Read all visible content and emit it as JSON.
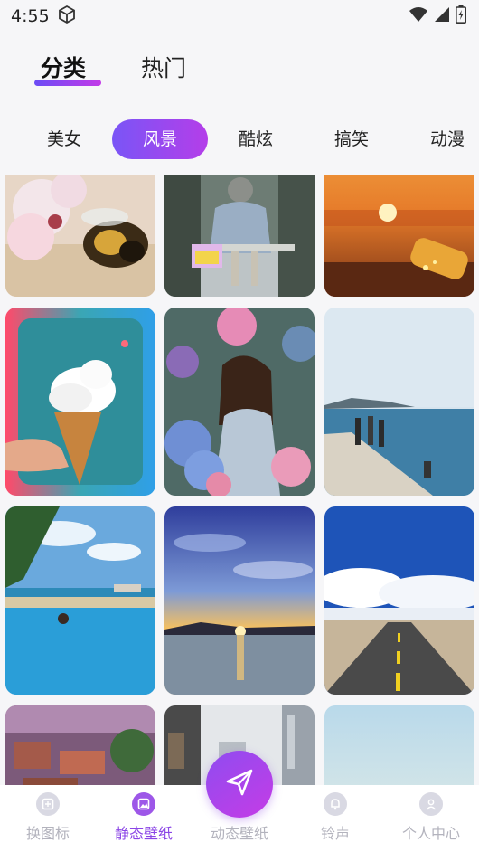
{
  "status_bar": {
    "time": "4:55",
    "icons": [
      "box-icon",
      "wifi-icon",
      "signal-icon",
      "battery-icon"
    ]
  },
  "top_tabs": [
    {
      "label": "分类",
      "active": true
    },
    {
      "label": "热门",
      "active": false
    }
  ],
  "categories": [
    {
      "label": "美女",
      "active": false
    },
    {
      "label": "风景",
      "active": true
    },
    {
      "label": "酷炫",
      "active": false
    },
    {
      "label": "搞笑",
      "active": false
    },
    {
      "label": "动漫",
      "active": false
    }
  ],
  "wallpapers": [
    {
      "subject": "bee-on-blossom"
    },
    {
      "subject": "girl-on-swing"
    },
    {
      "subject": "sunset-bottle-on-beach"
    },
    {
      "subject": "cloud-ice-cream-cone"
    },
    {
      "subject": "girl-in-flowers"
    },
    {
      "subject": "people-on-pier-by-sea"
    },
    {
      "subject": "infinity-pool-tropical"
    },
    {
      "subject": "sunset-over-lake"
    },
    {
      "subject": "road-under-blue-sky"
    },
    {
      "subject": "village-houses"
    },
    {
      "subject": "city-buildings"
    },
    {
      "subject": "pale-sky"
    }
  ],
  "bottom_nav": [
    {
      "label": "换图标",
      "icon": "replace-icon-icon",
      "active": false
    },
    {
      "label": "静态壁纸",
      "icon": "image-icon",
      "active": true
    },
    {
      "label": "动态壁纸",
      "icon": "send-icon",
      "active": false
    },
    {
      "label": "铃声",
      "icon": "bell-icon",
      "active": false
    },
    {
      "label": "个人中心",
      "icon": "user-icon",
      "active": false
    }
  ],
  "colors": {
    "accent_start": "#7a55f6",
    "accent_end": "#b43ee9",
    "nav_active": "#8b45e6",
    "nav_inactive": "#b3b3bd"
  }
}
